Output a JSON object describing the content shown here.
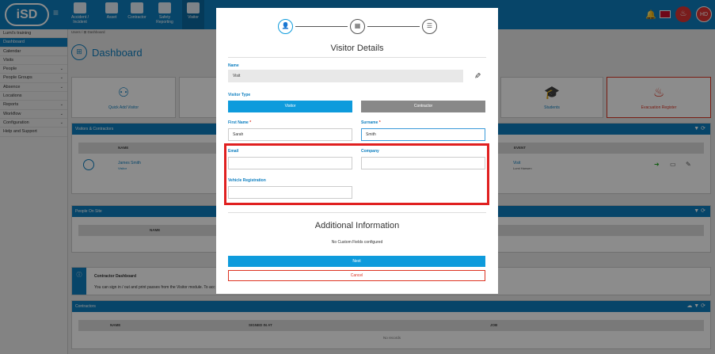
{
  "topbar": {
    "logo": "iSD",
    "nav": [
      {
        "label": "Accident / Incident",
        "icon": "clipboard-icon"
      },
      {
        "label": "Asset",
        "icon": "asset-icon"
      },
      {
        "label": "Contractor",
        "icon": "contractor-icon"
      },
      {
        "label": "Safety Reporting",
        "icon": "report-icon"
      },
      {
        "label": "Visitor",
        "icon": "visitor-icon"
      }
    ],
    "avatar": "HD"
  },
  "sidebar": {
    "items": [
      {
        "label": "Lumi's training",
        "chev": ""
      },
      {
        "label": "Dashboard",
        "chev": ""
      },
      {
        "label": "Calendar",
        "chev": ""
      },
      {
        "label": "Visits",
        "chev": ""
      },
      {
        "label": "People",
        "chev": "⌄"
      },
      {
        "label": "People Groups",
        "chev": "⌄"
      },
      {
        "label": "Absence",
        "chev": "⌄"
      },
      {
        "label": "Locations",
        "chev": ""
      },
      {
        "label": "Reports",
        "chev": "⌄"
      },
      {
        "label": "Workflow",
        "chev": "⌄"
      },
      {
        "label": "Configuration",
        "chev": "⌄"
      },
      {
        "label": "Help and Support",
        "chev": ""
      }
    ]
  },
  "main": {
    "breadcrumb": "Users / ⊞ Dashboard",
    "title": "Dashboard",
    "tiles": [
      {
        "label": "Quick Add Visitor"
      },
      {
        "label": "Students"
      },
      {
        "label": "Evacuation Register"
      }
    ],
    "visitors_panel": {
      "title": "Visitors & Contractors",
      "col_name": "NAME",
      "col_event": "EVENT",
      "row_name": "James Smith",
      "row_sub": "Visitor",
      "row_event": "Visit",
      "row_event_sub": "Lumi Hansen"
    },
    "onsite_panel": {
      "title": "People On Site",
      "col_name": "NAME"
    },
    "info_box": {
      "title": "Contractor Dashboard",
      "text": "You can sign in / out and print passes from the Visitor module. To acc"
    },
    "contractors_panel": {
      "title": "Contractors",
      "col_name": "NAME",
      "col_signed": "SIGNED IN AT",
      "col_job": "JOB",
      "empty": "No records"
    }
  },
  "modal": {
    "title": "Visitor Details",
    "steps": [
      "user-icon",
      "calendar-icon",
      "checklist-icon"
    ],
    "name_label": "Name",
    "name_value": "Visit",
    "visitor_type_label": "Visitor Type",
    "type_visitor": "Visitor",
    "type_contractor": "Contractor",
    "first_name_label": "First Name",
    "first_name_value": "Sarah",
    "surname_label": "Surname",
    "surname_value": "Smith",
    "email_label": "Email",
    "email_value": "",
    "company_label": "Company",
    "company_value": "",
    "vehicle_label": "Vehicle Registration",
    "vehicle_value": "",
    "required_mark": "*",
    "additional_title": "Additional Information",
    "no_custom": "No Custom Fields configured",
    "next": "Next",
    "cancel": "Cancel"
  },
  "colors": {
    "primary": "#0e7fc0",
    "accent": "#0e9bdc",
    "danger": "#e02020"
  }
}
